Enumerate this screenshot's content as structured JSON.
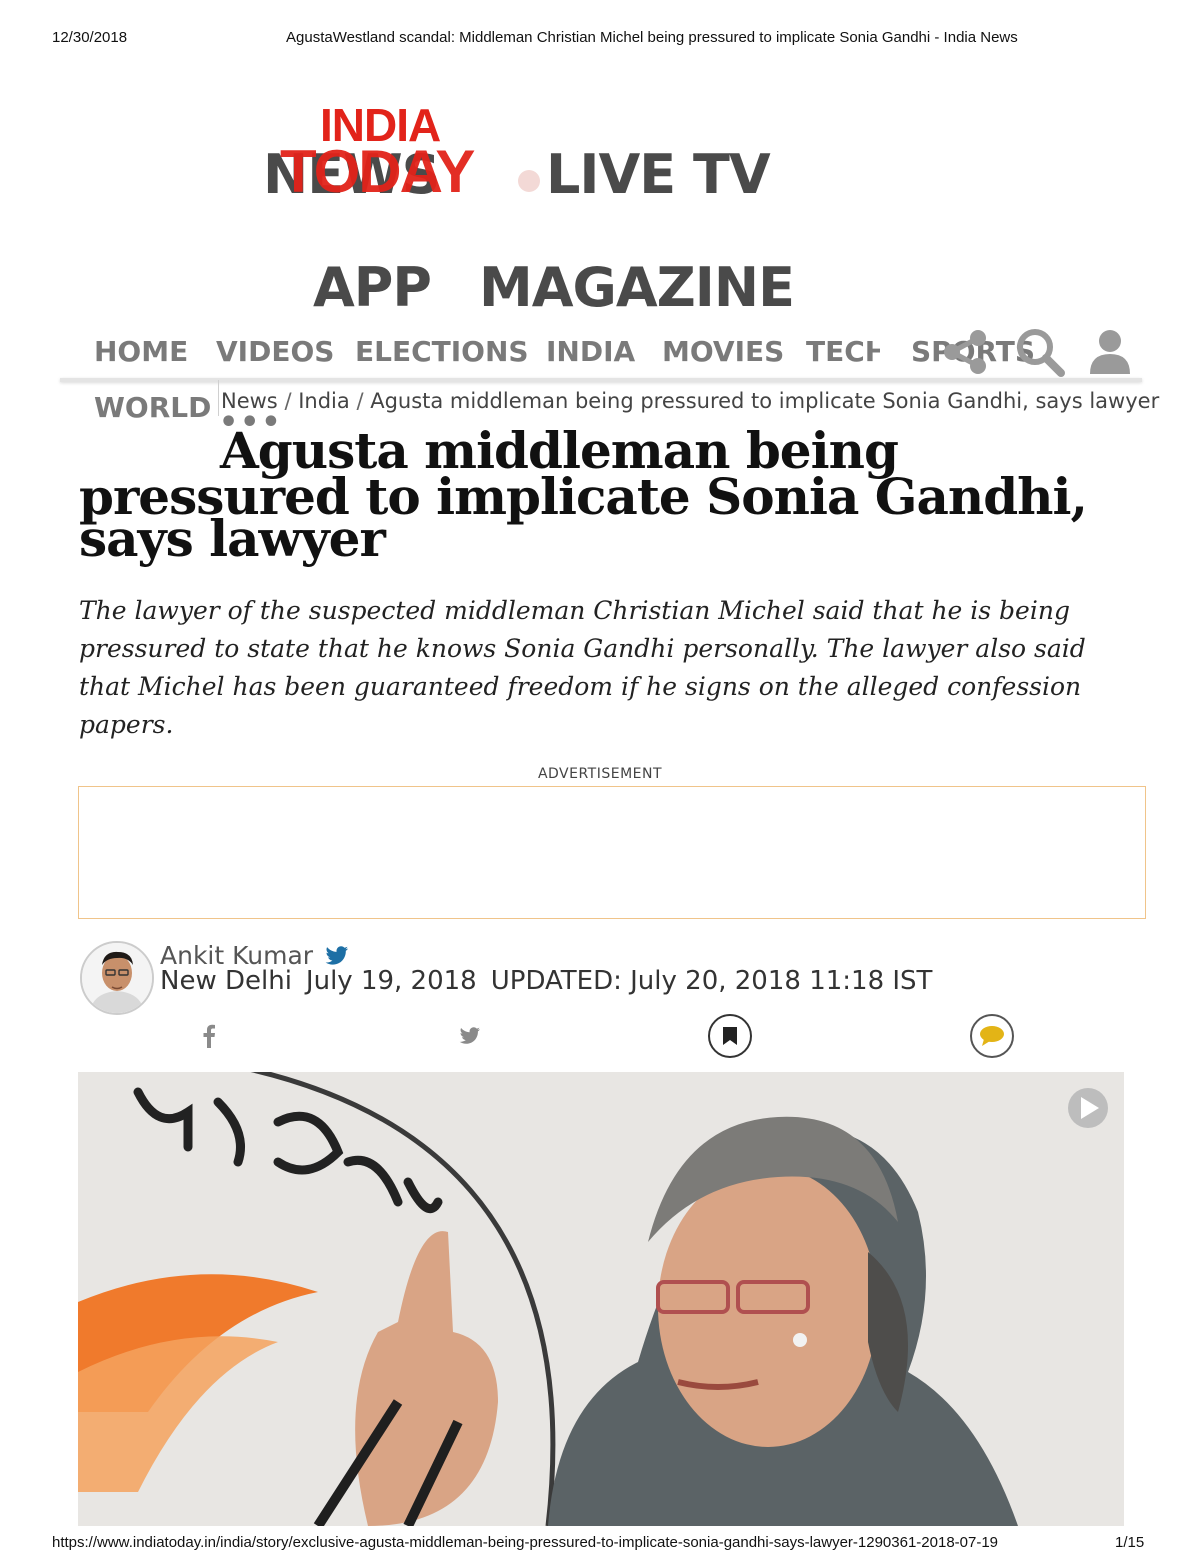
{
  "print_header": {
    "date": "12/30/2018",
    "title": "AgustaWestland scandal: Middleman Christian Michel being pressured to implicate Sonia Gandhi - India News"
  },
  "logo": {
    "line1": "INDIA",
    "line2": "TODAY"
  },
  "top_links": {
    "news": "NEWS",
    "live_tv": "LIVE TV",
    "app": "APP",
    "magazine": "MAGAZINE"
  },
  "nav": {
    "items": [
      "HOME",
      "VIDEOS",
      "ELECTIONS",
      "INDIA",
      "MOVIES",
      "TECH",
      "SPORTS",
      "WORLD"
    ],
    "more": "•••"
  },
  "breadcrumb": {
    "items": [
      "News",
      "India",
      "Agusta middleman being pressured to implicate Sonia Gandhi, says lawyer"
    ],
    "separator": "/"
  },
  "article": {
    "headline_line1": "Agusta middleman being",
    "headline_line2": "pressured to implicate Sonia Gandhi,",
    "headline_line3": "says lawyer",
    "summary": "The lawyer of the suspected middleman Christian Michel said that he is being pressured to state that he knows Sonia Gandhi personally. The lawyer also said that Michel has been guaranteed freedom if he signs on the alleged confession papers."
  },
  "advertisement": {
    "label": "ADVERTISEMENT"
  },
  "author": {
    "name": "Ankit Kumar",
    "location": "New Delhi",
    "date": "July 19, 2018",
    "updated": "UPDATED: July 20, 2018 11:18 IST"
  },
  "share": {
    "icons": [
      "facebook-icon",
      "twitter-icon",
      "bookmark-icon",
      "comment-icon"
    ]
  },
  "colors": {
    "brand_red": "#e2231a",
    "nav_gray": "#7a7a7a",
    "twitter_blue": "#1d6fa5",
    "comment_yellow": "#e3b416",
    "ad_border": "#f0c48a"
  },
  "print_footer": {
    "url": "https://www.indiatoday.in/india/story/exclusive-agusta-middleman-being-pressured-to-implicate-sonia-gandhi-says-lawyer-1290361-2018-07-19",
    "page": "1/15"
  }
}
